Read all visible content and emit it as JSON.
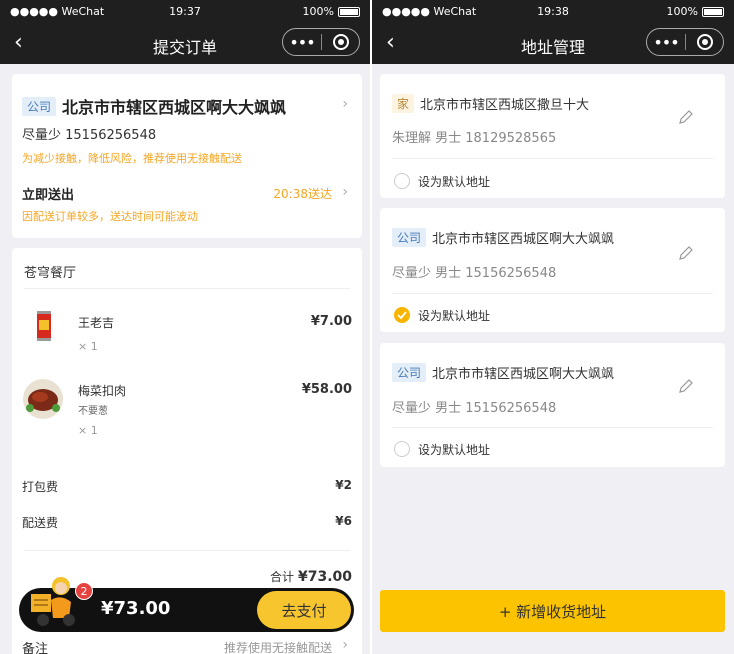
{
  "left": {
    "status": {
      "carrier": "●●●●● WeChat",
      "time": "19:37",
      "battery": "100%"
    },
    "nav": {
      "back_icon": "chevron-left-icon",
      "title": "提交订单"
    },
    "address_card": {
      "tag": "公司",
      "address": "北京市市辖区西城区啊大大飒飒",
      "contact": "尽量少 15156256548",
      "notice": "为减少接触，降低风险，推荐使用无接触配送",
      "delivery_label": "立即送出",
      "delivery_time": "20:38送达",
      "delivery_notice": "因配送订单较多，送达时间可能波动"
    },
    "restaurant": {
      "name": "苍穹餐厅",
      "items": [
        {
          "name": "王老吉",
          "note": "",
          "qty": "× 1",
          "price": "¥7.00"
        },
        {
          "name": "梅菜扣肉",
          "note": "不要葱",
          "qty": "× 1",
          "price": "¥58.00"
        }
      ],
      "packing_label": "打包费",
      "packing_value": "¥2",
      "delivery_fee_label": "配送费",
      "delivery_fee_value": "¥6",
      "total_label": "合计",
      "total_value": "¥73.00"
    },
    "cart": {
      "badge": "2",
      "amount": "¥73.00",
      "pay_label": "去支付"
    },
    "remark": {
      "label": "备注",
      "value": "推荐使用无接触配送"
    },
    "colors": {
      "accent": "#f7c62f",
      "notice": "#f6a623",
      "nav": "#1f1f1f"
    }
  },
  "right": {
    "status": {
      "carrier": "●●●●● WeChat",
      "time": "19:38",
      "battery": "100%"
    },
    "nav": {
      "back_icon": "chevron-left-icon",
      "title": "地址管理"
    },
    "addresses": [
      {
        "tag": "家",
        "address": "北京市市辖区西城区撒旦十大",
        "contact": "朱理解 男士  18129528565",
        "default_label": "设为默认地址",
        "is_default": false
      },
      {
        "tag": "公司",
        "address": "北京市市辖区西城区啊大大飒飒",
        "contact": "尽量少 男士  15156256548",
        "default_label": "设为默认地址",
        "is_default": true
      },
      {
        "tag": "公司",
        "address": "北京市市辖区西城区啊大大飒飒",
        "contact": "尽量少 男士  15156256548",
        "default_label": "设为默认地址",
        "is_default": false
      }
    ],
    "add_button": "+ 新增收货地址"
  }
}
